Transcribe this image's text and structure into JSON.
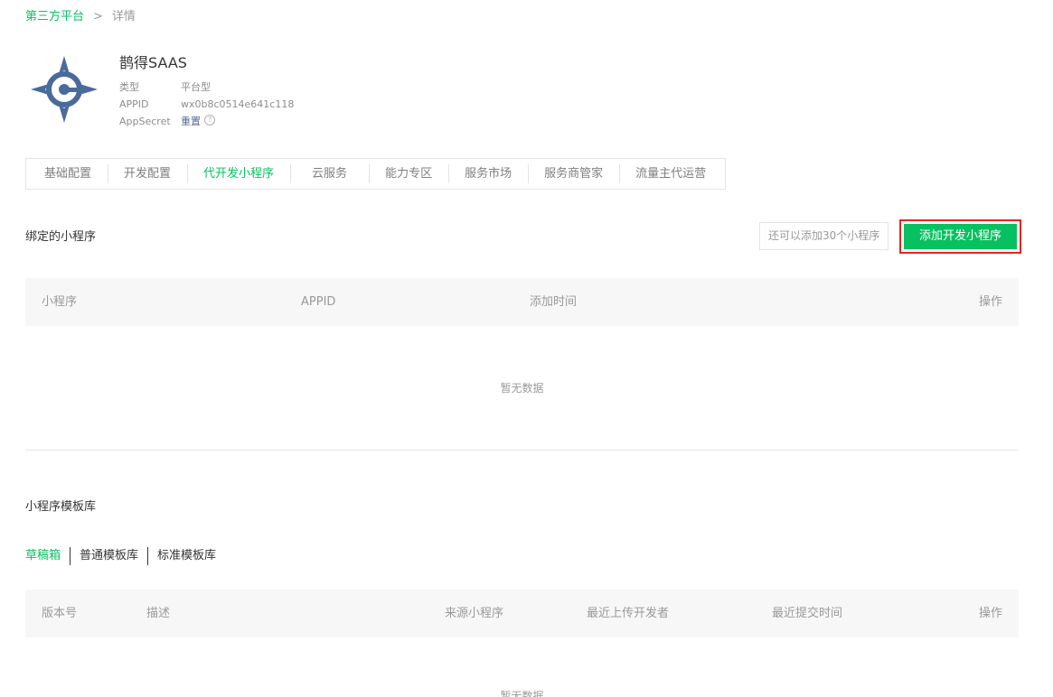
{
  "breadcrumb": {
    "parent": "第三方平台",
    "separator": ">",
    "current": "详情"
  },
  "app": {
    "logo_icon": "compass-logo-icon",
    "name": "鹊得SAAS",
    "type_label": "类型",
    "type_value": "平台型",
    "appid_label": "APPID",
    "appid_value": "wx0b8c0514e641c118",
    "secret_label": "AppSecret",
    "secret_action": "重置",
    "help_glyph": "?"
  },
  "tabs": [
    {
      "label": "基础配置",
      "active": false
    },
    {
      "label": "开发配置",
      "active": false
    },
    {
      "label": "代开发小程序",
      "active": true
    },
    {
      "label": "云服务",
      "active": false
    },
    {
      "label": "能力专区",
      "active": false
    },
    {
      "label": "服务市场",
      "active": false
    },
    {
      "label": "服务商管家",
      "active": false
    },
    {
      "label": "流量主代运营",
      "active": false
    }
  ],
  "bound": {
    "title": "绑定的小程序",
    "quota_text": "还可以添加30个小程序",
    "add_button": "添加开发小程序",
    "columns": [
      "小程序",
      "APPID",
      "添加时间",
      "操作"
    ],
    "empty_text": "暂无数据"
  },
  "templates": {
    "title": "小程序模板库",
    "subtabs": [
      {
        "label": "草稿箱",
        "active": true
      },
      {
        "label": "普通模板库",
        "active": false
      },
      {
        "label": "标准模板库",
        "active": false
      }
    ],
    "columns": [
      "版本号",
      "描述",
      "来源小程序",
      "最近上传开发者",
      "最近提交时间",
      "操作"
    ],
    "empty_text": "暂无数据"
  },
  "colors": {
    "accent": "#07c160",
    "highlight_border": "#e5251d",
    "link": "#576b95",
    "logo_blue": "#4a6a9c"
  }
}
